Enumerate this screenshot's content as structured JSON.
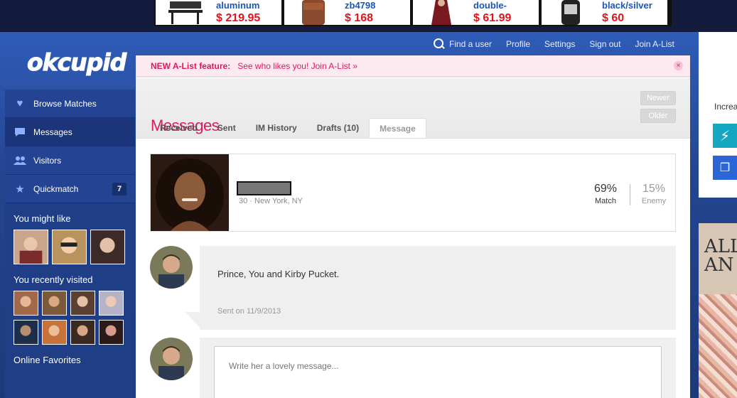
{
  "ads": [
    {
      "name": "aluminum",
      "price": "$ 219.95",
      "icon": "bench-icon"
    },
    {
      "name": "zb4798",
      "price": "$ 168",
      "icon": "bag-icon"
    },
    {
      "name": "double-",
      "price": "$ 61.99",
      "icon": "coat-icon"
    },
    {
      "name": "black/silver",
      "price": "$ 60",
      "icon": "watch-icon"
    }
  ],
  "logo": "okcupid",
  "topnav": {
    "find_user": "Find a user",
    "profile": "Profile",
    "settings": "Settings",
    "sign_out": "Sign out",
    "join_alist": "Join A-List"
  },
  "alist_bar": {
    "label": "NEW A-List feature:",
    "link": "See who likes you! Join A-List »",
    "close": "×"
  },
  "sidebar": {
    "items": [
      {
        "label": "Browse Matches",
        "icon": "heart-icon"
      },
      {
        "label": "Messages",
        "icon": "chat-icon"
      },
      {
        "label": "Visitors",
        "icon": "people-icon"
      },
      {
        "label": "Quickmatch",
        "icon": "star-icon",
        "badge": "7"
      }
    ],
    "might_like_heading": "You might like",
    "recently_visited_heading": "You recently visited",
    "online_favorites_heading": "Online Favorites"
  },
  "messages": {
    "title": "Messages",
    "newer": "Newer",
    "older": "Older",
    "tabs": [
      "Received",
      "Sent",
      "IM History",
      "Drafts (10)",
      "Message"
    ],
    "active_tab": "Message"
  },
  "profile": {
    "meta": "30 · New York, NY",
    "match_pct": "69%",
    "match_label": "Match",
    "enemy_pct": "15%",
    "enemy_label": "Enemy"
  },
  "message": {
    "text": "Prince, You and Kirby Pucket.",
    "date": "Sent on 11/9/2013"
  },
  "reply": {
    "placeholder": "Write her a lovely message..."
  },
  "right": {
    "text": "Increa",
    "ad_text": "ALL\nAN"
  },
  "colors": {
    "brand_pink": "#e5165d",
    "nav_blue": "#2f5cb8",
    "sidebar_blue": "#203e86"
  }
}
